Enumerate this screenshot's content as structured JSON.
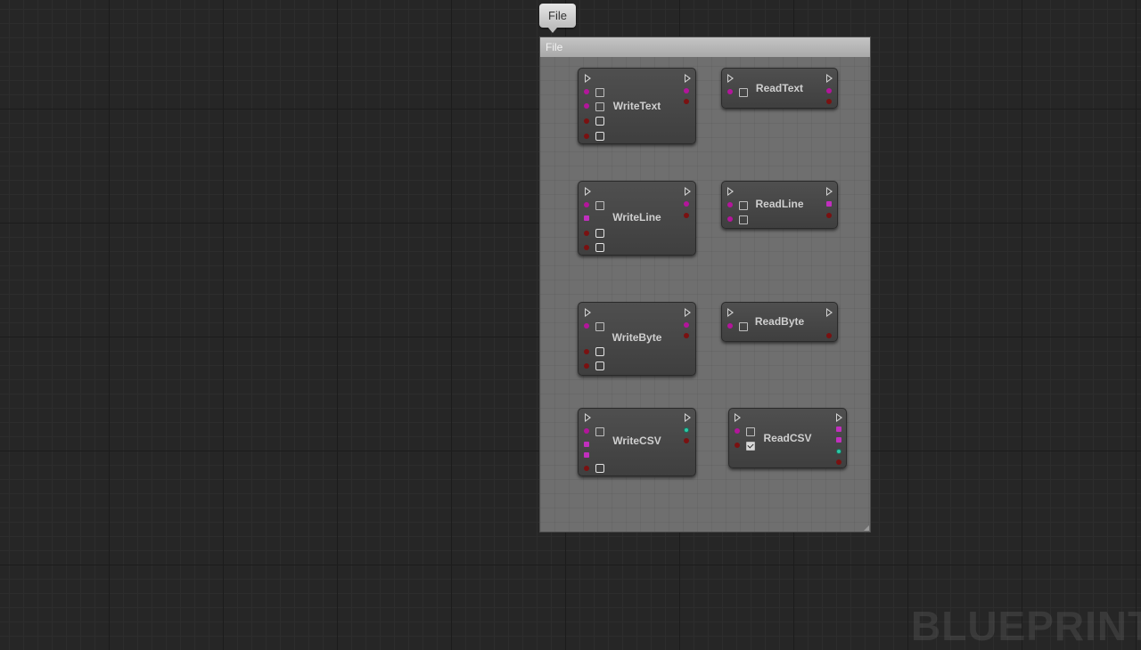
{
  "bubble": {
    "label": "File"
  },
  "comment": {
    "title": "File"
  },
  "nodes": {
    "write_text": {
      "title": "WriteText"
    },
    "read_text": {
      "title": "ReadText"
    },
    "write_line": {
      "title": "WriteLine"
    },
    "read_line": {
      "title": "ReadLine"
    },
    "write_byte": {
      "title": "WriteByte"
    },
    "read_byte": {
      "title": "ReadByte"
    },
    "write_csv": {
      "title": "WriteCSV"
    },
    "read_csv": {
      "title": "ReadCSV"
    }
  },
  "watermark": {
    "text": "BLUEPRINT"
  },
  "colors": {
    "object_pin": "#b3159b",
    "bool_pin": "#7a1111",
    "string_pin": "#c12fbe",
    "class_pin": "#2bc9a6",
    "comment_bg": "#6f6f6f",
    "node_bg": "#4a4a4a"
  }
}
